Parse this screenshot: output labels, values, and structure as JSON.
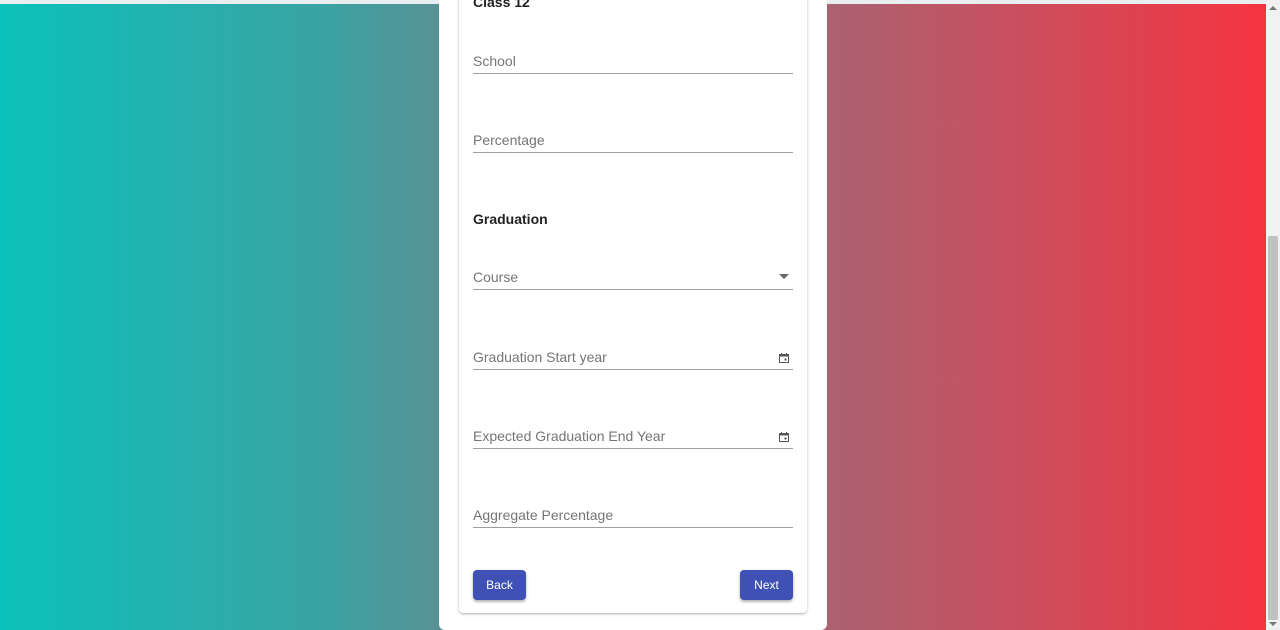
{
  "sections": {
    "class12_title": "Class 12",
    "graduation_title": "Graduation"
  },
  "fields": {
    "school": {
      "placeholder": "School",
      "value": ""
    },
    "percentage": {
      "placeholder": "Percentage",
      "value": ""
    },
    "course": {
      "placeholder": "Course",
      "value": ""
    },
    "grad_start": {
      "placeholder": "Graduation Start year",
      "value": ""
    },
    "grad_end": {
      "placeholder": "Expected Graduation End Year",
      "value": ""
    },
    "aggregate": {
      "placeholder": "Aggregate Percentage",
      "value": ""
    }
  },
  "buttons": {
    "back": "Back",
    "next": "Next"
  },
  "icons": {
    "course_dropdown": "chevron-down-icon",
    "start_year_calendar": "calendar-icon",
    "end_year_calendar": "calendar-icon"
  },
  "colors": {
    "primary": "#3f51b5",
    "gradient_start": "#0bc1bb",
    "gradient_end": "#f8323f"
  }
}
